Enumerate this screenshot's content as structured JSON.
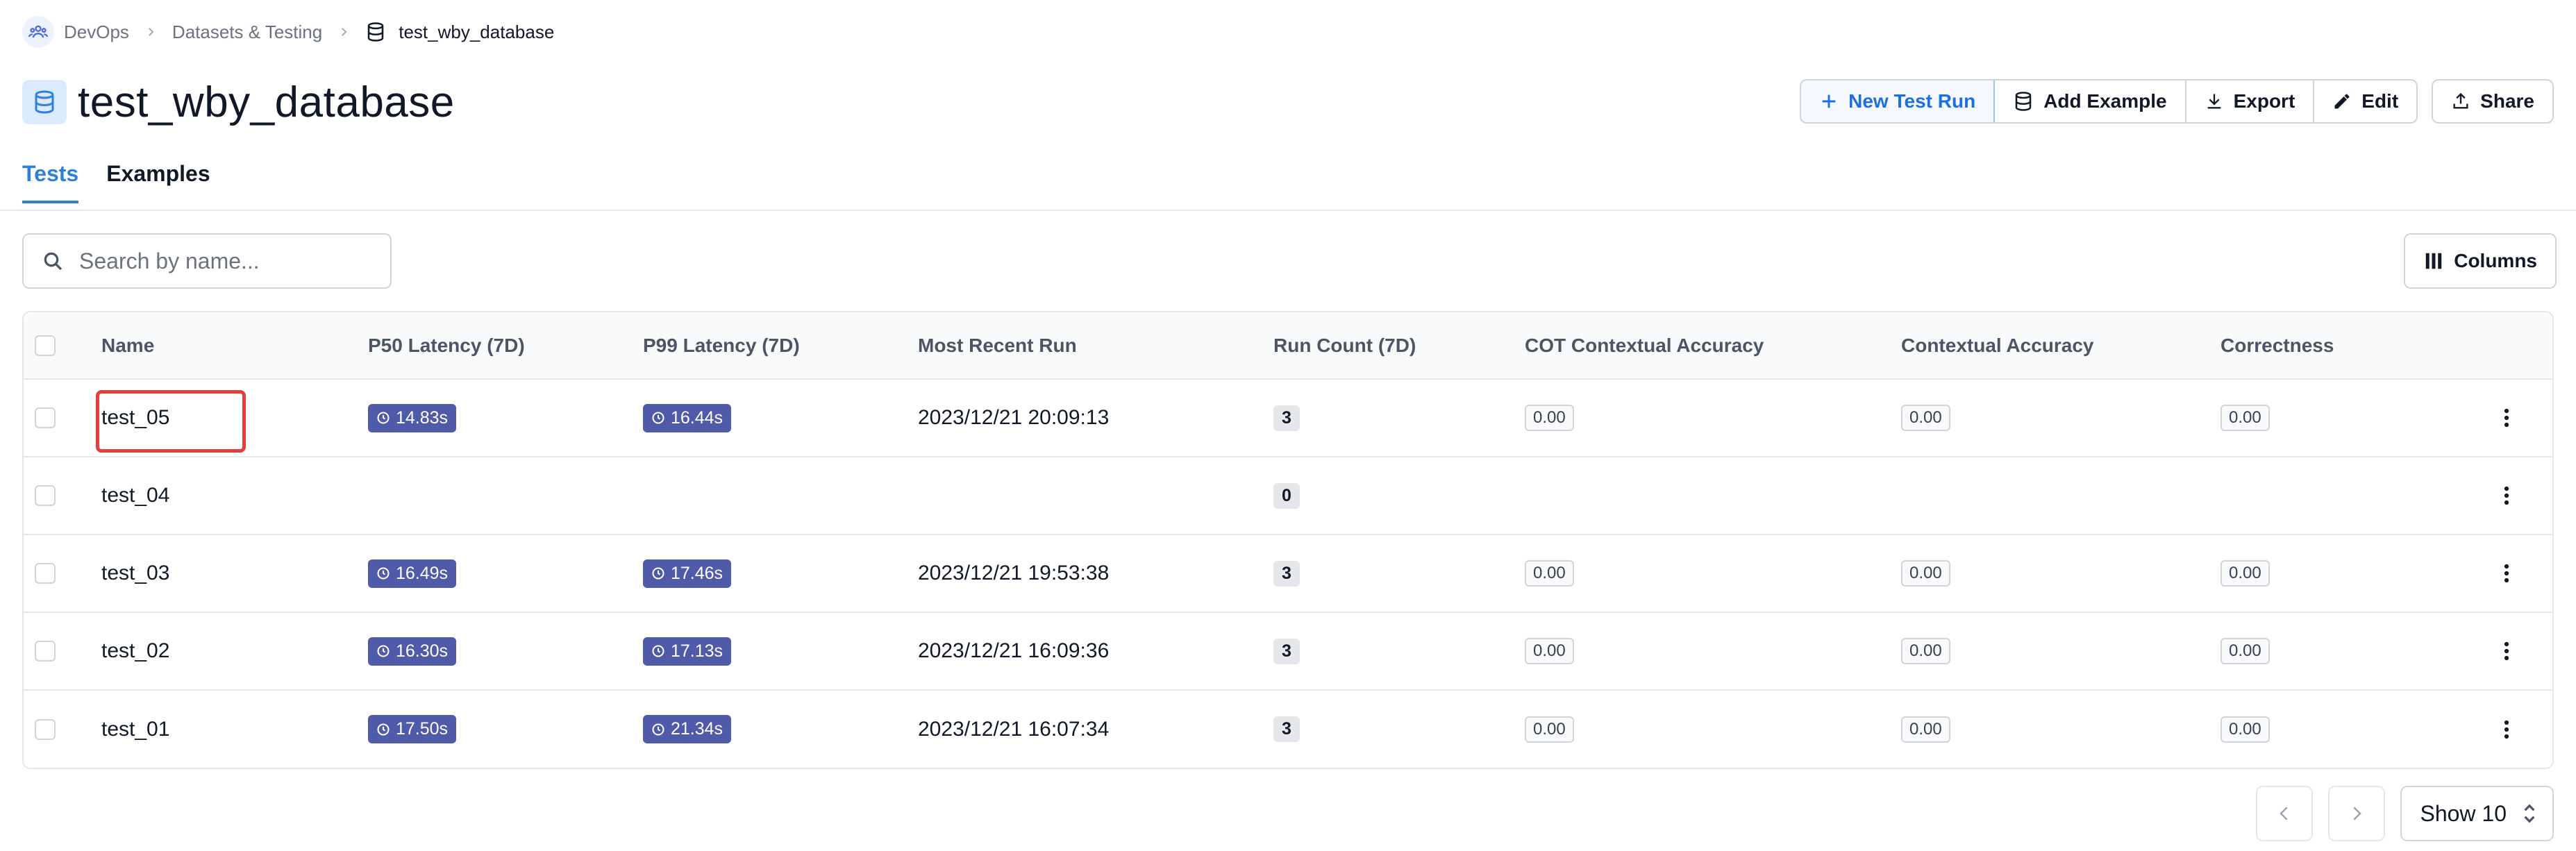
{
  "breadcrumb": {
    "org": "DevOps",
    "section": "Datasets & Testing",
    "current": "test_wby_database"
  },
  "page_title": "test_wby_database",
  "actions": {
    "new_test_run": "New Test Run",
    "add_example": "Add Example",
    "export": "Export",
    "edit": "Edit",
    "share": "Share"
  },
  "tabs": [
    {
      "label": "Tests",
      "active": true
    },
    {
      "label": "Examples",
      "active": false
    }
  ],
  "search": {
    "placeholder": "Search by name..."
  },
  "columns_button": "Columns",
  "table": {
    "headers": [
      "Name",
      "P50 Latency (7D)",
      "P99 Latency (7D)",
      "Most Recent Run",
      "Run Count (7D)",
      "COT Contextual Accuracy",
      "Contextual Accuracy",
      "Correctness"
    ],
    "rows": [
      {
        "name": "test_05",
        "p50": "14.83s",
        "p99": "16.44s",
        "recent": "2023/12/21 20:09:13",
        "count": "3",
        "cot": "0.00",
        "ctx": "0.00",
        "correct": "0.00"
      },
      {
        "name": "test_04",
        "p50": "",
        "p99": "",
        "recent": "",
        "count": "0",
        "cot": "",
        "ctx": "",
        "correct": ""
      },
      {
        "name": "test_03",
        "p50": "16.49s",
        "p99": "17.46s",
        "recent": "2023/12/21 19:53:38",
        "count": "3",
        "cot": "0.00",
        "ctx": "0.00",
        "correct": "0.00"
      },
      {
        "name": "test_02",
        "p50": "16.30s",
        "p99": "17.13s",
        "recent": "2023/12/21 16:09:36",
        "count": "3",
        "cot": "0.00",
        "ctx": "0.00",
        "correct": "0.00"
      },
      {
        "name": "test_01",
        "p50": "17.50s",
        "p99": "21.34s",
        "recent": "2023/12/21 16:07:34",
        "count": "3",
        "cot": "0.00",
        "ctx": "0.00",
        "correct": "0.00"
      }
    ]
  },
  "pagination": {
    "show_label": "Show 10"
  },
  "colors": {
    "accent": "#2f80d8",
    "latency_badge": "#4f5aa8",
    "highlight": "#e53e3e"
  }
}
